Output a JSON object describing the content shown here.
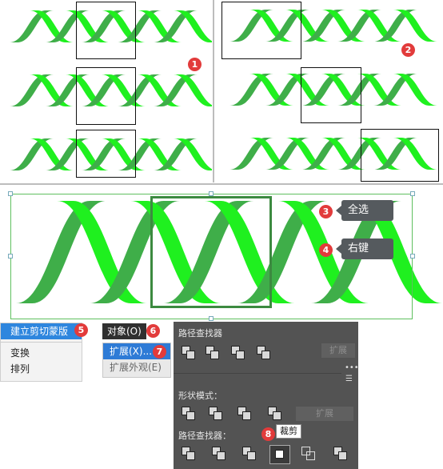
{
  "steps": {
    "s1": "1",
    "s2": "2",
    "s3": "3",
    "s4": "4",
    "s5": "5",
    "s6": "6",
    "s7": "7",
    "s8": "8"
  },
  "tooltips": {
    "select_all": "全选",
    "right_click": "右键"
  },
  "context_menu": {
    "items": [
      "建立剪切蒙版",
      "变换",
      "排列"
    ]
  },
  "object_menu": {
    "title": "对象(O)",
    "items": [
      "扩展(X)...",
      "扩展外观(E)"
    ]
  },
  "pathfinder": {
    "title": "路径查找器",
    "expand_label": "扩展",
    "shape_modes_label": "形状模式：",
    "pathfinders_label": "路径查找器：",
    "crop_tooltip": "裁剪"
  },
  "colors": {
    "green_light": "#1ff01f",
    "green_dark": "#3fae49",
    "panel_bg": "#535353",
    "badge": "#e23b3b"
  }
}
